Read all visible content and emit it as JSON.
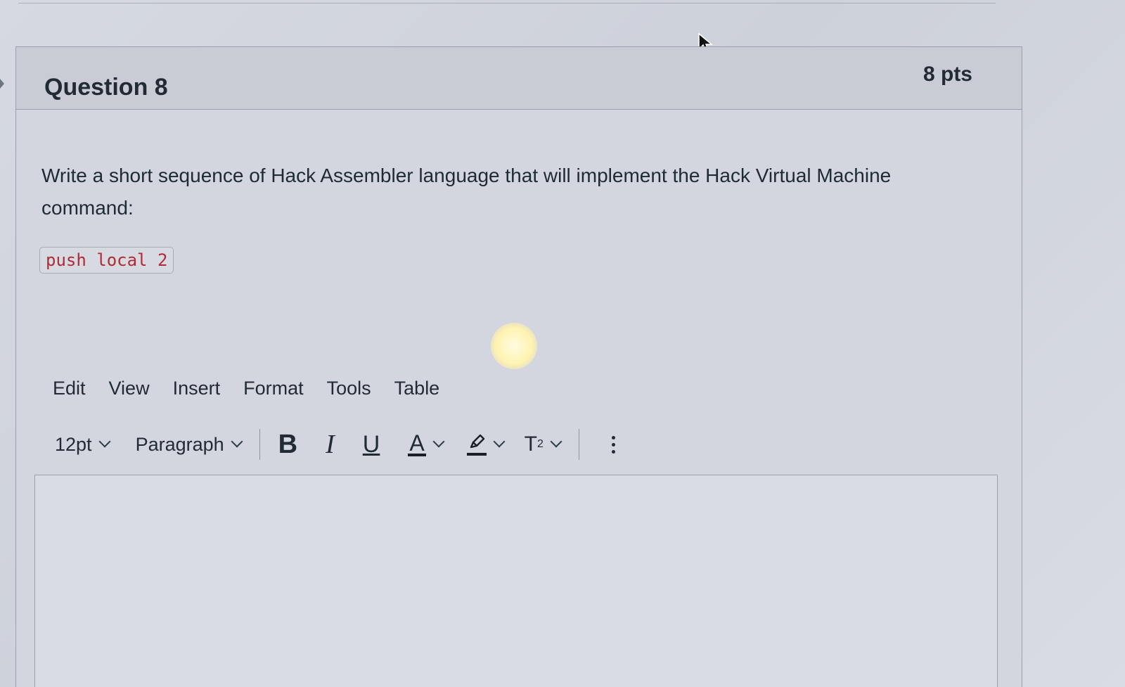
{
  "question": {
    "title": "Question 8",
    "points": "8 pts",
    "text": "Write a short sequence of Hack Assembler language that will implement the Hack Virtual Machine command:",
    "code": "push local 2"
  },
  "editor": {
    "menu": [
      "Edit",
      "View",
      "Insert",
      "Format",
      "Tools",
      "Table"
    ],
    "toolbar": {
      "font_size": "12pt",
      "block_format": "Paragraph",
      "bold_label": "B",
      "italic_label": "I",
      "underline_label": "U",
      "text_color_label": "A",
      "superscript_label": "T",
      "superscript_exp": "2"
    },
    "content": ""
  },
  "icons": [
    "chevron-down-icon",
    "pen-highlight-icon",
    "kebab-menu-icon",
    "mouse-cursor-icon",
    "left-arrow-icon"
  ]
}
